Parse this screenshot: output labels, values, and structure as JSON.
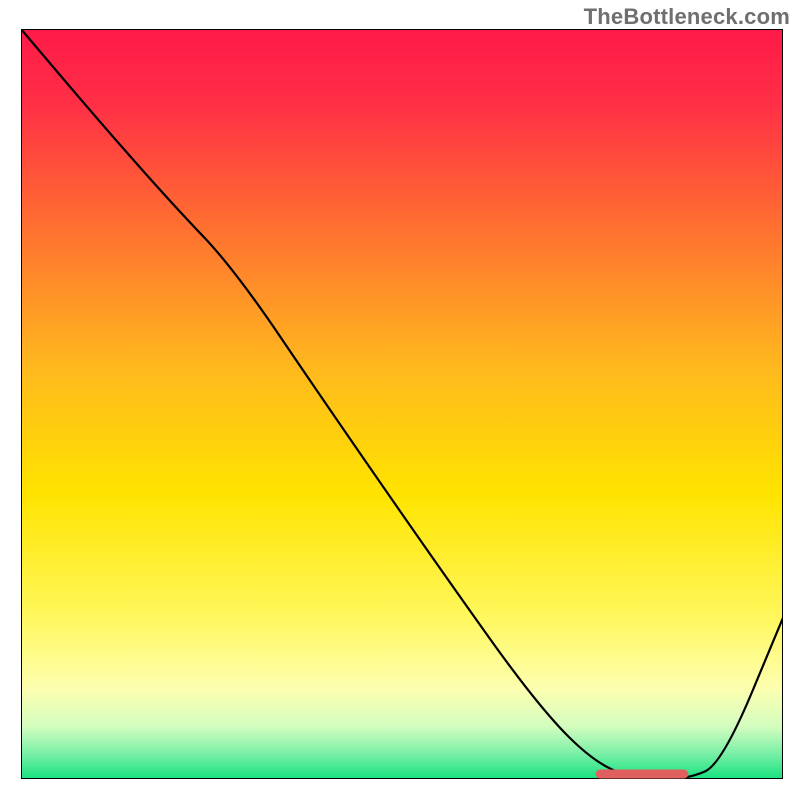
{
  "watermark": "TheBottleneck.com",
  "chart_data": {
    "type": "line",
    "title": "",
    "xlabel": "",
    "ylabel": "",
    "xlim": [
      0,
      100
    ],
    "ylim": [
      0,
      100
    ],
    "background_gradient": {
      "stops": [
        {
          "offset": 0.0,
          "color": "#ff1a49"
        },
        {
          "offset": 0.1,
          "color": "#ff2f46"
        },
        {
          "offset": 0.25,
          "color": "#ff6a32"
        },
        {
          "offset": 0.45,
          "color": "#ffb81e"
        },
        {
          "offset": 0.62,
          "color": "#ffe400"
        },
        {
          "offset": 0.78,
          "color": "#fff75a"
        },
        {
          "offset": 0.88,
          "color": "#fdffb0"
        },
        {
          "offset": 0.93,
          "color": "#d3fdbf"
        },
        {
          "offset": 0.965,
          "color": "#7df0a8"
        },
        {
          "offset": 1.0,
          "color": "#17e27f"
        }
      ]
    },
    "series": [
      {
        "name": "main-curve",
        "color": "#000000",
        "x": [
          0,
          10,
          20,
          28,
          40,
          55,
          68,
          76,
          82,
          87.5,
          92,
          100
        ],
        "values": [
          100,
          88,
          76.5,
          68,
          50,
          28,
          9.5,
          1.5,
          0,
          0,
          2,
          21.5
        ]
      }
    ],
    "marker": {
      "name": "optimal-zone-marker",
      "color": "#e06060",
      "x_range": [
        76,
        87
      ],
      "y": 0,
      "thickness": 1.2
    }
  }
}
